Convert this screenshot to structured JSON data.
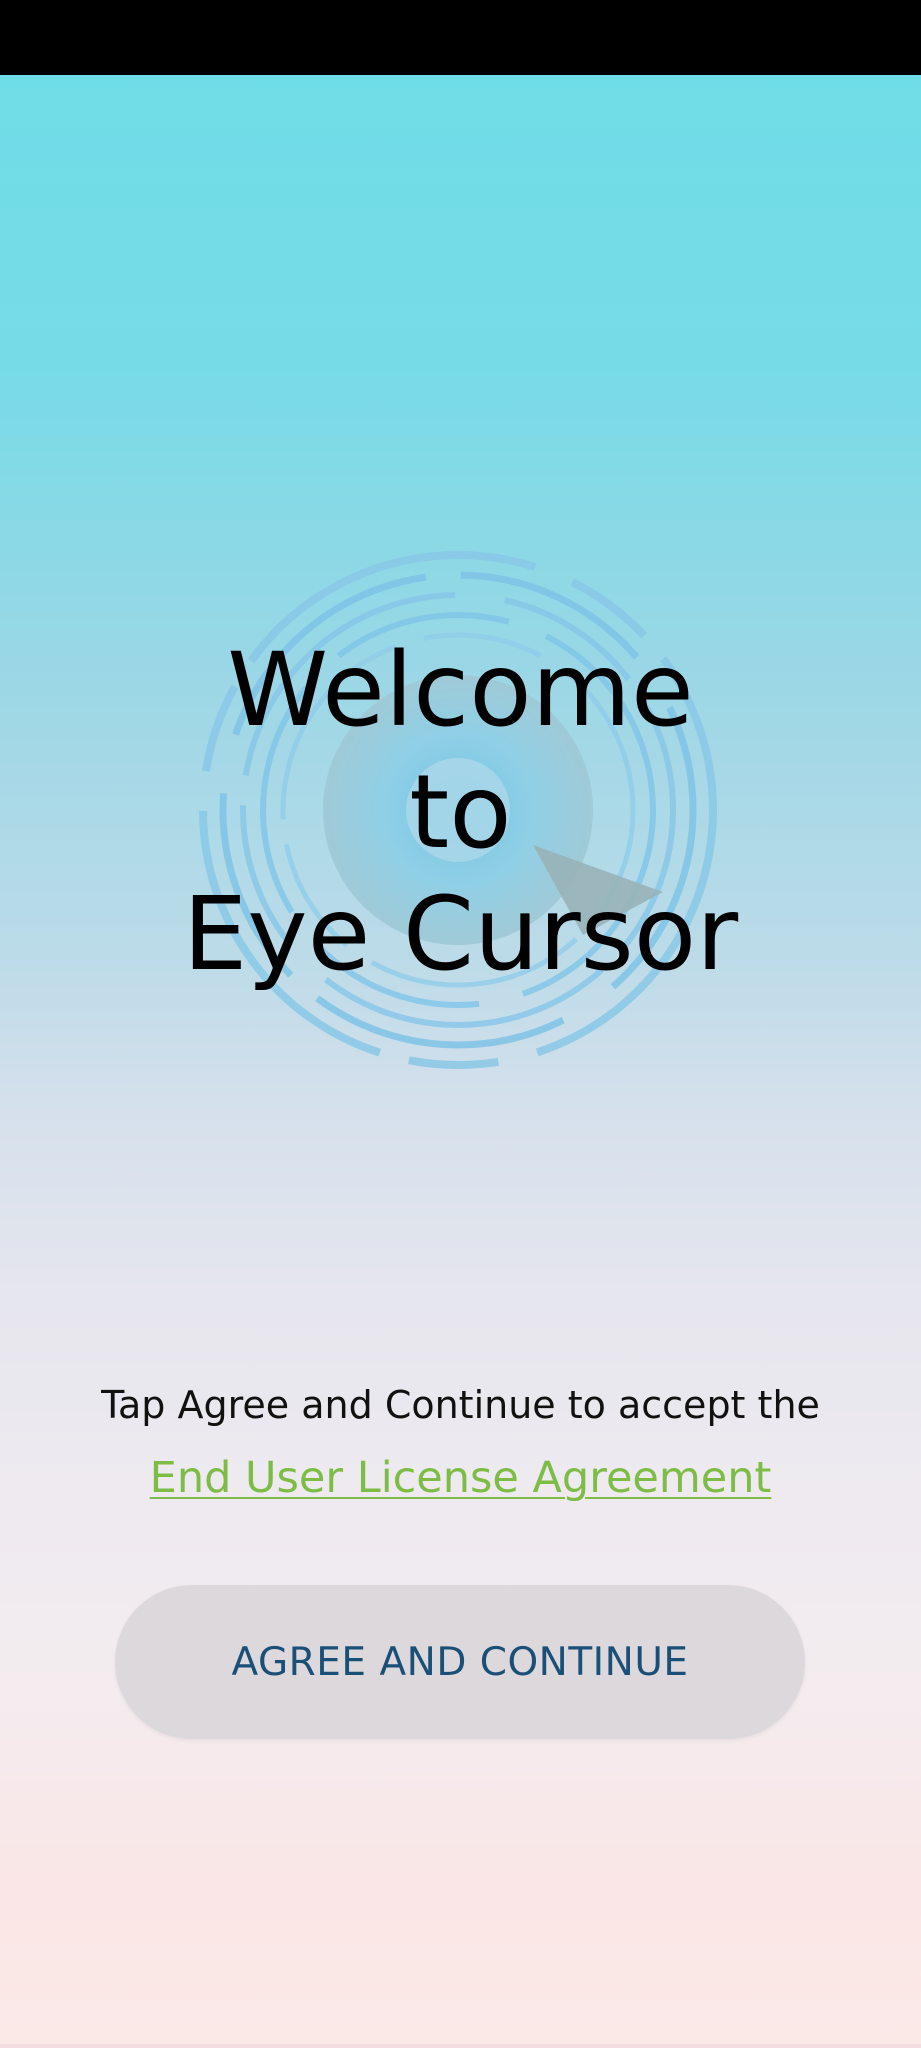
{
  "welcome": {
    "line1": "Welcome",
    "line2": "to",
    "line3": "Eye Cursor"
  },
  "consent": {
    "text": "Tap Agree and Continue to accept the",
    "link_label": "End User License Agreement"
  },
  "agree_button": {
    "label": "AGREE AND CONTINUE"
  },
  "colors": {
    "link": "#7ebd45",
    "button_text": "#1a4f78",
    "button_bg": "#ddd8db"
  },
  "icons": {
    "emblem": "eye-cursor-logo-icon"
  }
}
